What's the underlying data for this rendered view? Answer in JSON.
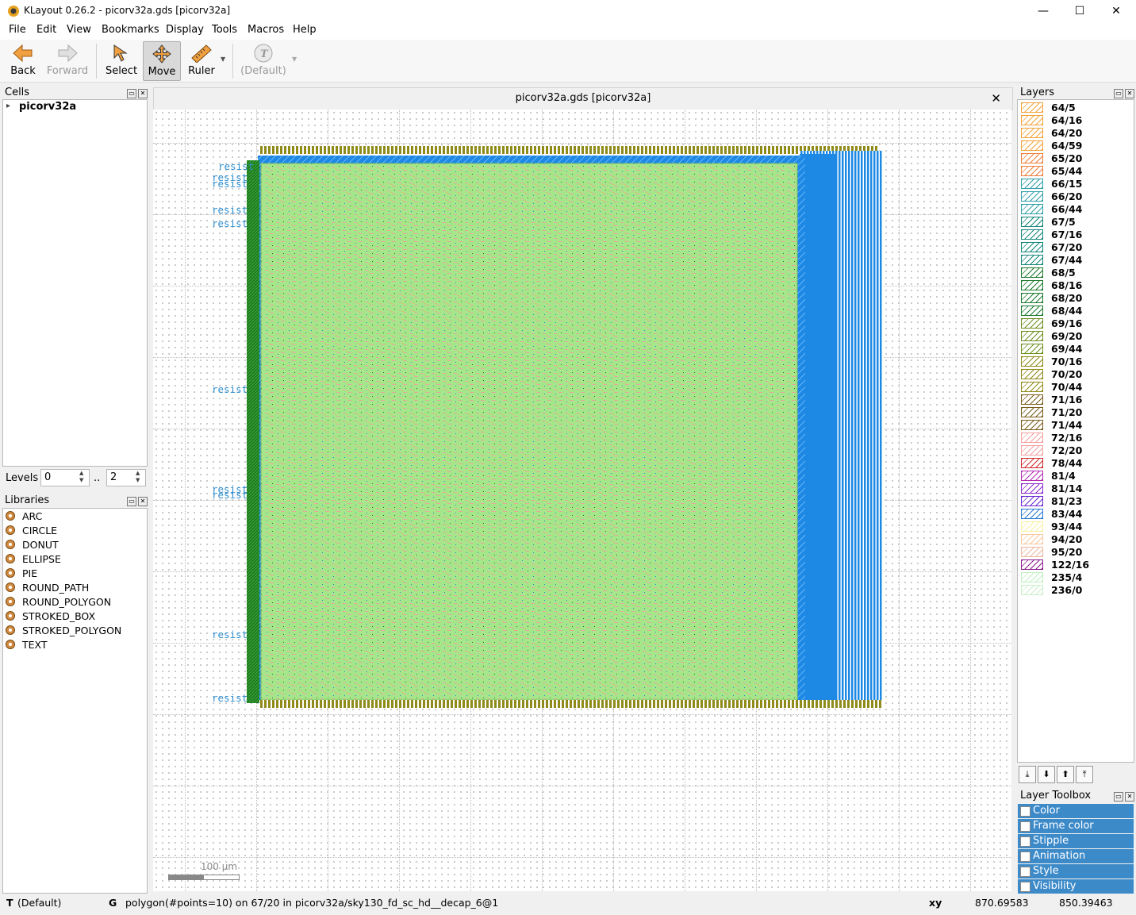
{
  "window": {
    "title": "KLayout 0.26.2 - picorv32a.gds [picorv32a]",
    "minimize": "—",
    "maximize": "☐",
    "close": "✕"
  },
  "menu": [
    "File",
    "Edit",
    "View",
    "Bookmarks",
    "Display",
    "Tools",
    "Macros",
    "Help"
  ],
  "toolbar": {
    "back": "Back",
    "forward": "Forward",
    "select": "Select",
    "move": "Move",
    "ruler": "Ruler",
    "text_default": "(Default)"
  },
  "cells": {
    "title": "Cells",
    "root": "picorv32a",
    "levels_label": "Levels",
    "level_from": "0",
    "level_sep": "..",
    "level_to": "2"
  },
  "libraries": {
    "title": "Libraries",
    "items": [
      "ARC",
      "CIRCLE",
      "DONUT",
      "ELLIPSE",
      "PIE",
      "ROUND_PATH",
      "ROUND_POLYGON",
      "STROKED_BOX",
      "STROKED_POLYGON",
      "TEXT"
    ]
  },
  "view": {
    "title": "picorv32a.gds [picorv32a]",
    "scale_label": "100 µm",
    "resist_label": "resist"
  },
  "layers": {
    "title": "Layers",
    "items": [
      {
        "name": "64/5",
        "color": "#f2a33a"
      },
      {
        "name": "64/16",
        "color": "#f2a33a"
      },
      {
        "name": "64/20",
        "color": "#f2a33a"
      },
      {
        "name": "64/59",
        "color": "#f2a33a"
      },
      {
        "name": "65/20",
        "color": "#ee7d3b"
      },
      {
        "name": "65/44",
        "color": "#ee7d3b"
      },
      {
        "name": "66/15",
        "color": "#2ea0a8"
      },
      {
        "name": "66/20",
        "color": "#2ea0a8"
      },
      {
        "name": "66/44",
        "color": "#2ea0a8"
      },
      {
        "name": "67/5",
        "color": "#15877a"
      },
      {
        "name": "67/16",
        "color": "#15877a"
      },
      {
        "name": "67/20",
        "color": "#15877a"
      },
      {
        "name": "67/44",
        "color": "#15877a"
      },
      {
        "name": "68/5",
        "color": "#1c7a2d"
      },
      {
        "name": "68/16",
        "color": "#1c7a2d"
      },
      {
        "name": "68/20",
        "color": "#1c7a2d"
      },
      {
        "name": "68/44",
        "color": "#1c7a2d"
      },
      {
        "name": "69/16",
        "color": "#6c8f1e"
      },
      {
        "name": "69/20",
        "color": "#6c8f1e"
      },
      {
        "name": "69/44",
        "color": "#6c8f1e"
      },
      {
        "name": "70/16",
        "color": "#8f8a1a"
      },
      {
        "name": "70/20",
        "color": "#8f8a1a"
      },
      {
        "name": "70/44",
        "color": "#8f8a1a"
      },
      {
        "name": "71/16",
        "color": "#7a5c1c"
      },
      {
        "name": "71/20",
        "color": "#7a5c1c"
      },
      {
        "name": "71/44",
        "color": "#7a5c1c"
      },
      {
        "name": "72/16",
        "color": "#f4a0a0"
      },
      {
        "name": "72/20",
        "color": "#f4a0a0"
      },
      {
        "name": "78/44",
        "color": "#d22a2a"
      },
      {
        "name": "81/4",
        "color": "#b02ab0"
      },
      {
        "name": "81/14",
        "color": "#8a2ad0"
      },
      {
        "name": "81/23",
        "color": "#6a2ad0"
      },
      {
        "name": "83/44",
        "color": "#2a7ad0"
      },
      {
        "name": "93/44",
        "color": "#f8f0a0"
      },
      {
        "name": "94/20",
        "color": "#f8c8a0"
      },
      {
        "name": "95/20",
        "color": "#f0b8a0"
      },
      {
        "name": "122/16",
        "color": "#8a1a8a"
      },
      {
        "name": "235/4",
        "color": "#c0f0c0"
      },
      {
        "name": "236/0",
        "color": "#c8f0c8"
      }
    ]
  },
  "layer_toolbox": {
    "title": "Layer Toolbox",
    "items": [
      "Color",
      "Frame color",
      "Stipple",
      "Animation",
      "Style",
      "Visibility"
    ]
  },
  "status": {
    "mode_key": "T",
    "mode_value": "(Default)",
    "g_key": "G",
    "message": "polygon(#points=10) on 67/20 in picorv32a/sky130_fd_sc_hd__decap_6@1",
    "xy_label": "xy",
    "x": "870.69583",
    "y": "850.39463"
  },
  "colors": {
    "accent": "#3d8ac9",
    "core_green": "#a8e88c",
    "blue_fill": "#1e88e5",
    "dark_green": "#1f7a1f"
  }
}
